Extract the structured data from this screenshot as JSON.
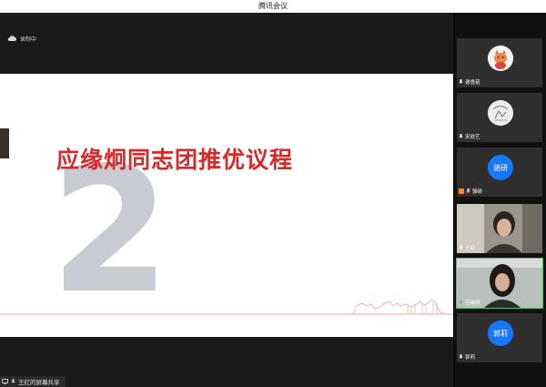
{
  "window": {
    "title": "腾讯会议"
  },
  "status": {
    "recording_label": "录制中"
  },
  "slide": {
    "title": "应缘炯同志团推优议程",
    "section_number": "2"
  },
  "screen_share": {
    "label": "王红的屏幕共享"
  },
  "participants": [
    {
      "name": "谢逸韬",
      "avatar": "cartoon-avatar",
      "mic": "on"
    },
    {
      "name": "宋欣艺",
      "avatar": "sketch-avatar",
      "mic": "on"
    },
    {
      "name": "骆研",
      "avatar_text": "骆研",
      "mic": "off"
    },
    {
      "name": "王红",
      "avatar": "video-feed",
      "mic": "on"
    },
    {
      "name": "应缘炯",
      "avatar": "video-feed",
      "mic": "on",
      "speaking": true
    },
    {
      "name": "郭莉",
      "avatar_text": "郭莉",
      "mic": "on"
    }
  ],
  "colors": {
    "title_red": "#d42a2a",
    "avatar_blue": "#1677ff",
    "active_green": "#5cc06a"
  }
}
